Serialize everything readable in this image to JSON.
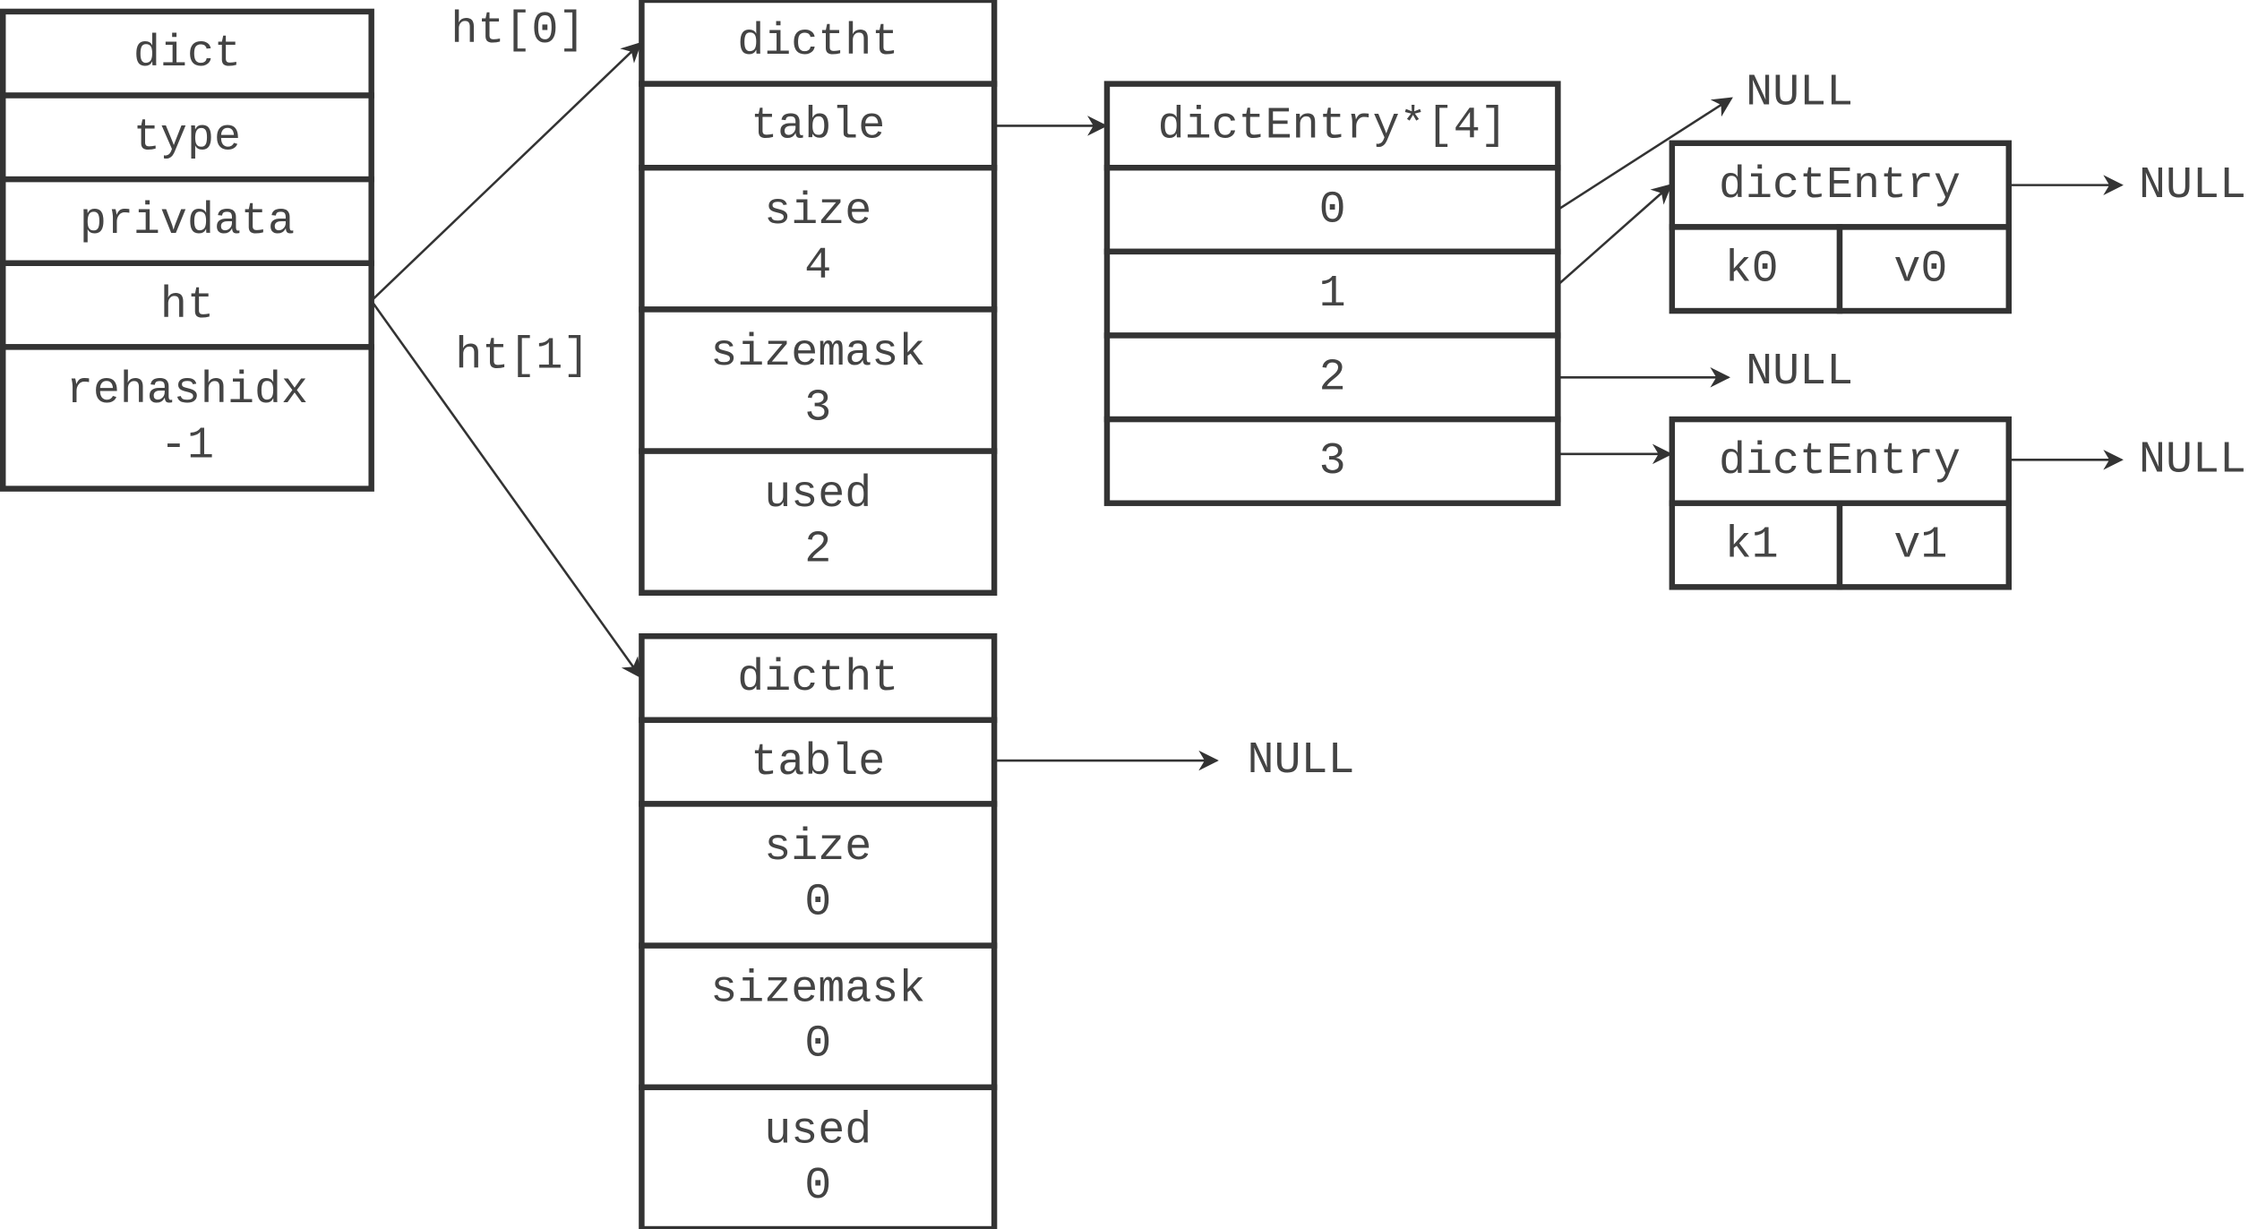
{
  "dict": {
    "rows": [
      [
        "dict"
      ],
      [
        "type"
      ],
      [
        "privdata"
      ],
      [
        "ht"
      ],
      [
        "rehashidx",
        "-1"
      ]
    ]
  },
  "labels": {
    "ht0": "ht[0]",
    "ht1": "ht[1]"
  },
  "ht0": {
    "rows": [
      [
        "dictht"
      ],
      [
        "table"
      ],
      [
        "size",
        "4"
      ],
      [
        "sizemask",
        "3"
      ],
      [
        "used",
        "2"
      ]
    ]
  },
  "ht1": {
    "rows": [
      [
        "dictht"
      ],
      [
        "table"
      ],
      [
        "size",
        "0"
      ],
      [
        "sizemask",
        "0"
      ],
      [
        "used",
        "0"
      ]
    ]
  },
  "table": {
    "rows": [
      [
        "dictEntry*[4]"
      ],
      [
        "0"
      ],
      [
        "1"
      ],
      [
        "2"
      ],
      [
        "3"
      ]
    ]
  },
  "entries": [
    {
      "title": "dictEntry",
      "key": "k0",
      "value": "v0",
      "next": "NULL"
    },
    {
      "title": "dictEntry",
      "key": "k1",
      "value": "v1",
      "next": "NULL"
    }
  ],
  "nulls": {
    "bucket0": "NULL",
    "bucket2": "NULL",
    "ht1_table": "NULL"
  }
}
